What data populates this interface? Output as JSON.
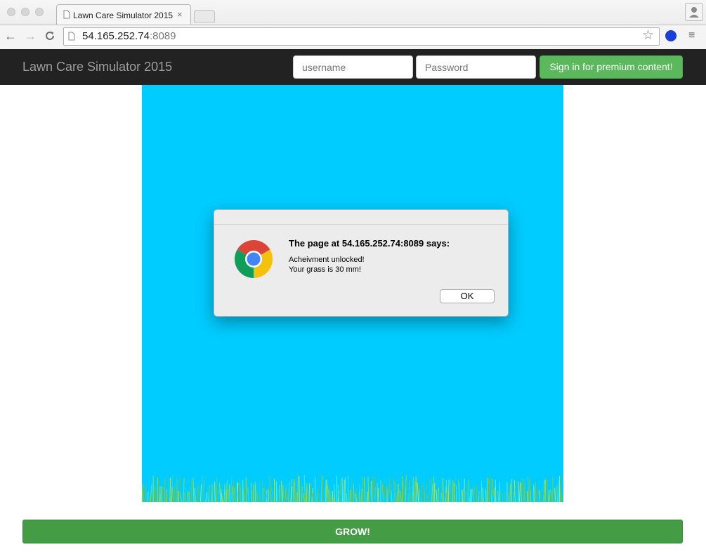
{
  "browser": {
    "tab_title": "Lawn Care Simulator 2015",
    "tab_close": "×",
    "url_host": "54.165.252.74",
    "url_port": ":8089",
    "back_icon": "←",
    "forward_icon": "→",
    "reload_icon": "C",
    "star_icon": "☆",
    "menu_icon": "≡"
  },
  "navbar": {
    "brand": "Lawn Care Simulator 2015",
    "username_placeholder": "username",
    "password_placeholder": "Password",
    "signin_label": "Sign in for premium content!"
  },
  "dialog": {
    "title": "The page at 54.165.252.74:8089 says:",
    "message": "Acheivment unlocked!\nYour grass is 30 mm!",
    "ok_label": "OK"
  },
  "main": {
    "grow_label": "GROW!"
  },
  "colors": {
    "sky": "#00ccff",
    "grass": "#7ee06a",
    "grow_button": "#449d44",
    "signin_button": "#5cb85c"
  }
}
